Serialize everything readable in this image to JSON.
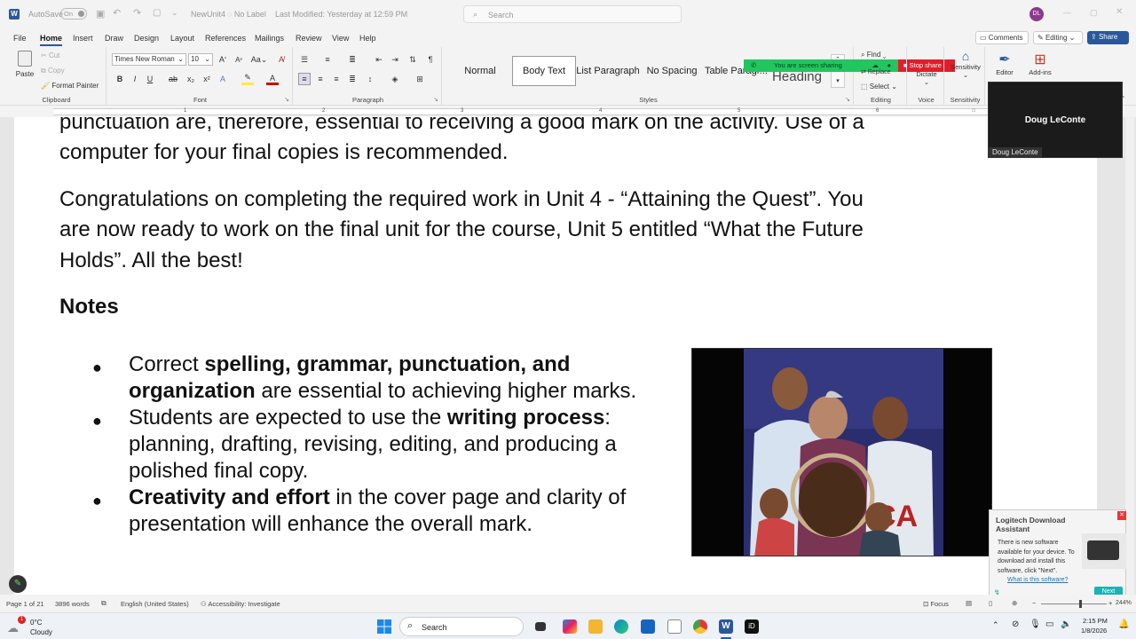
{
  "title_bar": {
    "autosave_label": "AutoSave",
    "autosave_state": "On",
    "file_name": "NewUnit4",
    "label_status": "No Label",
    "last_modified": "Last Modified: Yesterday at 12:59 PM",
    "search_placeholder": "Search",
    "user_initials": "DL"
  },
  "menu": {
    "items": [
      "File",
      "Home",
      "Insert",
      "Draw",
      "Design",
      "Layout",
      "References",
      "Mailings",
      "Review",
      "View",
      "Help"
    ],
    "active": "Home",
    "comments_label": "Comments",
    "editing_label": "Editing",
    "share_label": "Share"
  },
  "ribbon": {
    "paste": "Paste",
    "cut": "Cut",
    "copy": "Copy",
    "format_painter": "Format Painter",
    "clipboard": "Clipboard",
    "font_name": "Times New Roman",
    "font_size": "10",
    "font_group": "Font",
    "paragraph_group": "Paragraph",
    "styles": [
      "Normal",
      "Body Text",
      "List Paragraph",
      "No Spacing",
      "Table Paragr..."
    ],
    "heading_style": "Heading",
    "styles_group": "Styles",
    "find": "Find",
    "replace": "Replace",
    "select": "Select",
    "editing_group": "Editing",
    "dictate": "Dictate",
    "voice_group": "Voice",
    "sensitivity": "Sensitivity",
    "sensitivity_group": "Sensitivity",
    "editor": "Editor",
    "addins": "Add-ins",
    "screen_sharing": "You are screen sharing",
    "stop_share": "Stop share"
  },
  "ruler": {
    "ticks": [
      "1",
      "2",
      "3",
      "4",
      "5",
      "6"
    ]
  },
  "document": {
    "para1_line1": "punctuation are, therefore, essential to receiving a good mark on the activity. Use of a",
    "para1_line2": "computer for your final copies is recommended.",
    "para2_line1": "Congratulations on completing the required work in Unit 4 - “Attaining the Quest”. You",
    "para2_line2": "are now ready to work on the final unit for the course, Unit 5 entitled “What the Future",
    "para2_line3": "Holds”. All the best!",
    "notes_heading": "Notes",
    "bullet1_pre": "Correct ",
    "bullet1_bold": "spelling, grammar, punctuation, and",
    "bullet1_bold2": "organization",
    "bullet1_post": " are essential to achieving higher marks.",
    "bullet2_pre": "Students are expected to use the ",
    "bullet2_bold": "writing process",
    "bullet2_post": ":",
    "bullet2_line2": "planning, drafting, revising, editing, and producing a",
    "bullet2_line3": "polished final copy.",
    "bullet3_bold": "Creativity and effort",
    "bullet3_post": " in the cover page and clarity of",
    "bullet3_line2": "presentation will enhance the overall mark."
  },
  "video_tile": {
    "name": "Doug LeConte",
    "caption": "Doug LeConte"
  },
  "notification": {
    "title": "Logitech Download Assistant",
    "body": "There is new software available for your device. To download and install this software, click \"Next\".",
    "link": "What is this software?",
    "next": "Next"
  },
  "status_bar": {
    "page": "Page 1 of 21",
    "words": "3896 words",
    "language": "English (United States)",
    "accessibility": "Accessibility: Investigate",
    "focus": "Focus",
    "zoom": "244%"
  },
  "taskbar": {
    "weather_temp": "0°C",
    "weather_desc": "Cloudy",
    "weather_badge": "1",
    "search_placeholder": "Search",
    "time": "2:15 PM",
    "date": "1/8/2026"
  }
}
